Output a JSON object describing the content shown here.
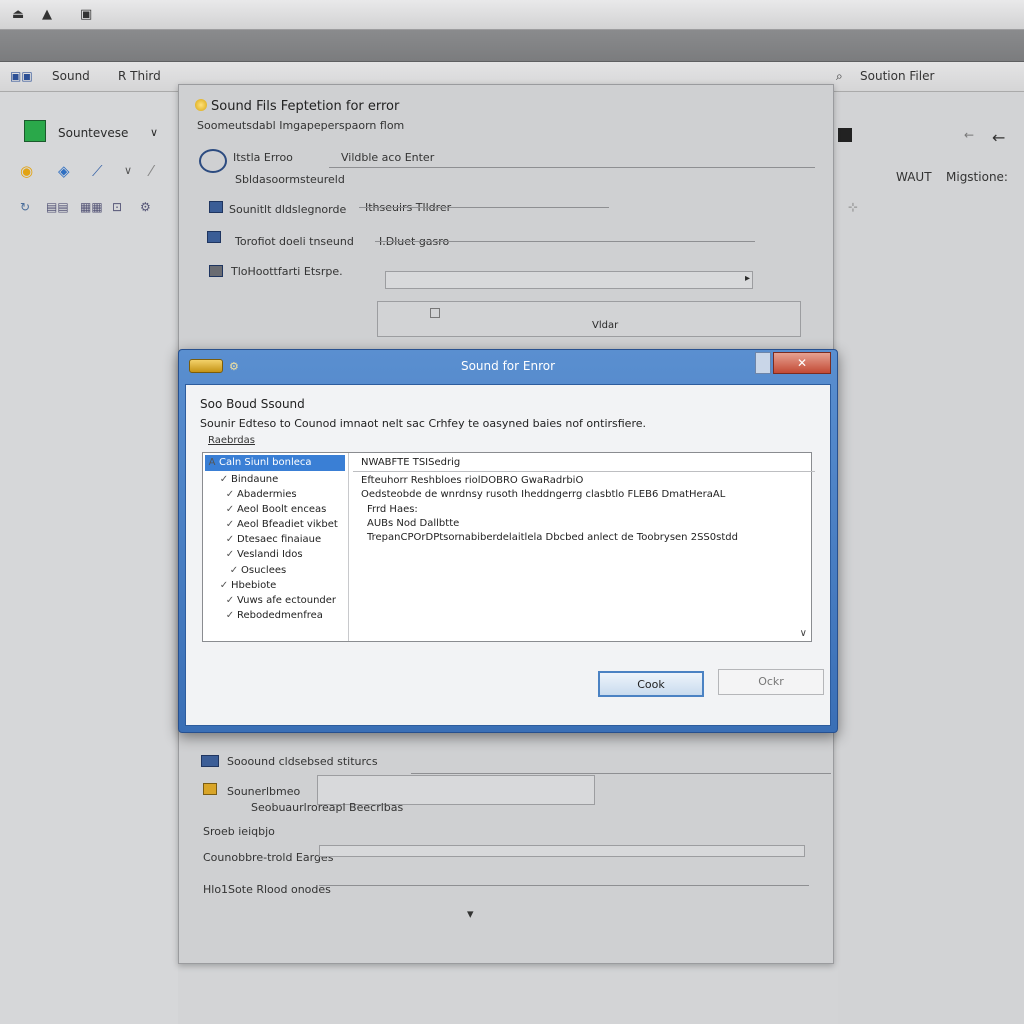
{
  "topbar": {
    "icons": [
      "⏏",
      "▲",
      "▣"
    ]
  },
  "toolbar": {
    "item1": "Sound",
    "item2": "R Third",
    "right_label": "Soution Filer"
  },
  "left_toolbar": {
    "label": "Sountevese"
  },
  "right_toolbar": {
    "item1": "WAUT",
    "item2": "Migstione:"
  },
  "bg_dialog": {
    "title": "Sound Fils Feptetion for error",
    "subtitle": "Soomeutsdabl Imgapeperspaorn flom",
    "rows": [
      {
        "label": "Itstla Erroo",
        "value": "Vildble aco Enter"
      },
      {
        "label": "Sbldasoormsteureld",
        "value": ""
      },
      {
        "label": "Sounitlt dldslegnorde",
        "value": "Ithseuirs Tlldrer"
      },
      {
        "label": "Torofiot doeli tnseund",
        "value": "I.Dluet gasro"
      },
      {
        "label": "TloHoottfarti Etsrpe.",
        "value": ""
      }
    ],
    "box_label": "Vldar",
    "lower": {
      "row1": "Sooound cldsebsed stiturcs",
      "row2": "Sounerlbmeo",
      "row3": "Seobuaurlroreapl Beecrlbas",
      "row4": "Sroeb ieiqbjo",
      "row5": "Counobbre-trold Earges",
      "row6": "Hlo1Sote Rlood onodes"
    }
  },
  "dialog": {
    "title": "Sound for Enror",
    "close_glyph": "✕",
    "heading": "Soo Boud Ssound",
    "description": "Sounir Edteso to Counod imnaot nelt sac Crhfey te oasyned baies nof ontirsfiere.",
    "group_label": "Raebrdas",
    "tree": [
      {
        "check": "A",
        "label": "Caln Siunl bonleca"
      },
      {
        "check": "✓",
        "label": "Bindaune"
      },
      {
        "check": "✓",
        "label": "Abadermies"
      },
      {
        "check": "✓",
        "label": "Aeol Boolt enceas"
      },
      {
        "check": "✓",
        "label": "Aeol Bfeadiet vikbet"
      },
      {
        "check": "✓",
        "label": "Dtesaec finaiaue"
      },
      {
        "check": "✓",
        "label": "Veslandi Idos"
      },
      {
        "check": "✓",
        "label": "Osuclees"
      },
      {
        "check": "✓",
        "label": "Hbebiote"
      },
      {
        "check": "✓",
        "label": "Vuws afe ectounder"
      },
      {
        "check": "✓",
        "label": "Rebodedmenfrea"
      }
    ],
    "detail": {
      "header": "NWABFTE TSISedrig",
      "lines": [
        "Efteuhorr Reshbloes riolDOBRO GwaRadrbiO",
        "Oedsteobde de wnrdnsy rusoth Iheddngerrg clasbtlo FLEB6 DmatHeraAL",
        "Frrd Haes:",
        "AUBs Nod Dallbtte",
        "TrepanCPOrDPtsornabiberdelaitlela Dbcbed anlect de Toobrysen 2SS0stdd"
      ]
    },
    "ok_label": "Cook",
    "cancel_label": "Ockr"
  }
}
